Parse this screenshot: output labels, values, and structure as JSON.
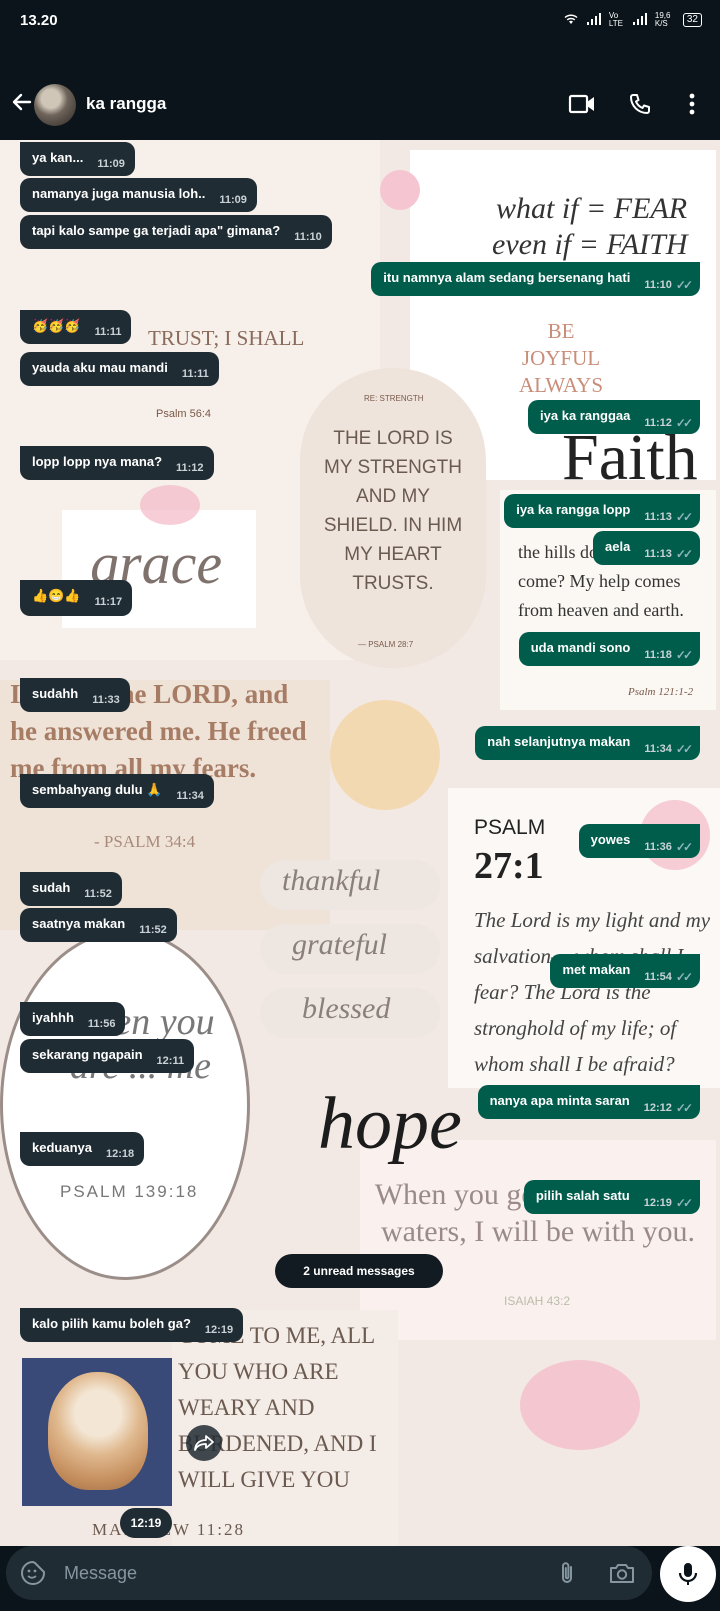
{
  "status": {
    "time": "13.20",
    "network": "Vo LTE",
    "speed": "19,6 K/S",
    "battery": "32"
  },
  "header": {
    "contact_name": "ka rangga"
  },
  "messages": [
    {
      "text": "ya kan...",
      "time": "11:09",
      "dir": "in"
    },
    {
      "text": "namanya juga manusia loh..",
      "time": "11:09",
      "dir": "in"
    },
    {
      "text": "tapi kalo sampe ga terjadi apa\" gimana?",
      "time": "11:10",
      "dir": "in"
    },
    {
      "text": "itu namnya alam sedang bersenang hati",
      "time": "11:10",
      "dir": "out"
    },
    {
      "text": "🥳🥳🥳",
      "time": "11:11",
      "dir": "in"
    },
    {
      "text": "yauda aku mau mandi",
      "time": "11:11",
      "dir": "in"
    },
    {
      "text": "iya ka ranggaa",
      "time": "11:12",
      "dir": "out"
    },
    {
      "text": "lopp lopp nya mana?",
      "time": "11:12",
      "dir": "in"
    },
    {
      "text": "iya ka rangga lopp",
      "time": "11:13",
      "dir": "out"
    },
    {
      "text": "aela",
      "time": "11:13",
      "dir": "out"
    },
    {
      "text": "👍😁👍",
      "time": "11:17",
      "dir": "in"
    },
    {
      "text": "uda mandi sono",
      "time": "11:18",
      "dir": "out"
    },
    {
      "text": "sudahh",
      "time": "11:33",
      "dir": "in"
    },
    {
      "text": "nah selanjutnya makan",
      "time": "11:34",
      "dir": "out"
    },
    {
      "text": "sembahyang dulu 🙏",
      "time": "11:34",
      "dir": "in"
    },
    {
      "text": "yowes",
      "time": "11:36",
      "dir": "out"
    },
    {
      "text": "sudah",
      "time": "11:52",
      "dir": "in"
    },
    {
      "text": "saatnya makan",
      "time": "11:52",
      "dir": "in"
    },
    {
      "text": "met makan",
      "time": "11:54",
      "dir": "out"
    },
    {
      "text": "iyahhh",
      "time": "11:56",
      "dir": "in"
    },
    {
      "text": "sekarang ngapain",
      "time": "12:11",
      "dir": "in"
    },
    {
      "text": "nanya apa minta saran",
      "time": "12:12",
      "dir": "out"
    },
    {
      "text": "keduanya",
      "time": "12:18",
      "dir": "in"
    },
    {
      "text": "pilih salah satu",
      "time": "12:19",
      "dir": "out"
    },
    {
      "text": "kalo pilih kamu boleh ga?",
      "time": "12:19",
      "dir": "in"
    }
  ],
  "unread_label": "2 unread messages",
  "photo_message": {
    "time": "12:19"
  },
  "wallpaper": {
    "what_if": "what if = FEAR",
    "even_if": "even if = FAITH",
    "be_joyful": "BE JOYFUL ALWAYS",
    "faith": "Faith",
    "trust": "TRUST; I SHALL",
    "psalm_56": "Psalm 56:4",
    "strength_label": "RE: STRENGTH",
    "strength": "THE LORD IS MY STRENGTH AND MY SHIELD. IN HIM MY HEART TRUSTS.",
    "psalm_28": "— PSALM 28:7",
    "grace": "grace",
    "hills": "the hills does my help come? My help comes from heaven and earth.",
    "psalm_121": "Psalm 121:1-2",
    "lord_answered": "I sought the LORD, and he answered me. He freed me from all my fears.",
    "psalm_34": "- PSALM 34:4",
    "thankful": "thankful",
    "grateful": "grateful",
    "blessed": "blessed",
    "psalm_label": "PSALM",
    "psalm_27": "27:1",
    "lord_light": "The Lord is my light and my salvation— whom shall I fear? The Lord is the stronghold of my life; of whom shall I be afraid?",
    "when_you": "when you are ... me",
    "psalm_139": "PSALM 139:18",
    "hope": "hope",
    "deep_waters": "When you go through deep waters, I will be with you.",
    "isaiah": "ISAIAH 43:2",
    "come_to_me": "COME TO ME, ALL YOU WHO ARE WEARY AND BURDENED, AND I WILL GIVE YOU REST.",
    "matthew": "MATTHEW 11:28"
  },
  "input": {
    "placeholder": "Message"
  }
}
